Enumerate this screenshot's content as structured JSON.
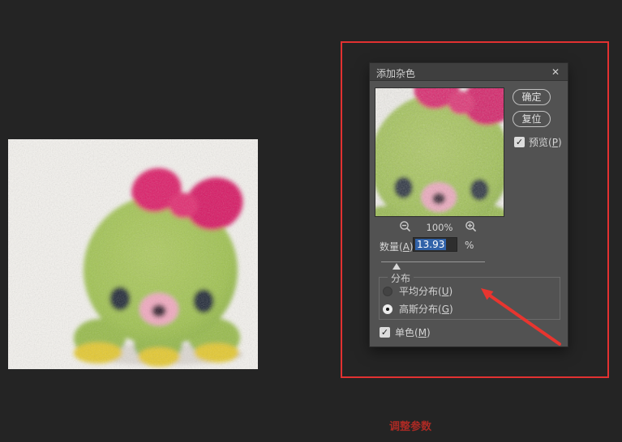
{
  "window": {
    "background": "#242424"
  },
  "dialog": {
    "title": "添加杂色",
    "close_icon": "✕",
    "ok_button": "确定",
    "reset_button": "复位",
    "preview_checkbox": {
      "pre": "预览(",
      "key": "P",
      "post": ")",
      "checked": true,
      "checkmark": "✓"
    },
    "zoom_level": "100%",
    "amount": {
      "pre": "数量(",
      "key": "A",
      "post": "):",
      "value": "13.93",
      "unit": "%",
      "slider_percent": 14
    },
    "distribution": {
      "label": "分布",
      "uniform": {
        "pre": "平均分布(",
        "key": "U",
        "post": ")",
        "selected": false
      },
      "gaussian": {
        "pre": "高斯分布(",
        "key": "G",
        "post": ")",
        "selected": true
      }
    },
    "monochrome": {
      "pre": "单色(",
      "key": "M",
      "post": ")",
      "checked": true,
      "checkmark": "✓"
    }
  },
  "annotations": {
    "caption": "调整参数",
    "highlight_color": "#e23131",
    "caption_color": "#ab2a24"
  },
  "photo_colors": {
    "background": "#f4f2ee",
    "body_green": "#a2c455",
    "bow_pink": "#dd1f68",
    "mouth_pink": "#f2a9c0",
    "feet_yellow": "#e5c92f",
    "eye_dark": "#232a37"
  }
}
